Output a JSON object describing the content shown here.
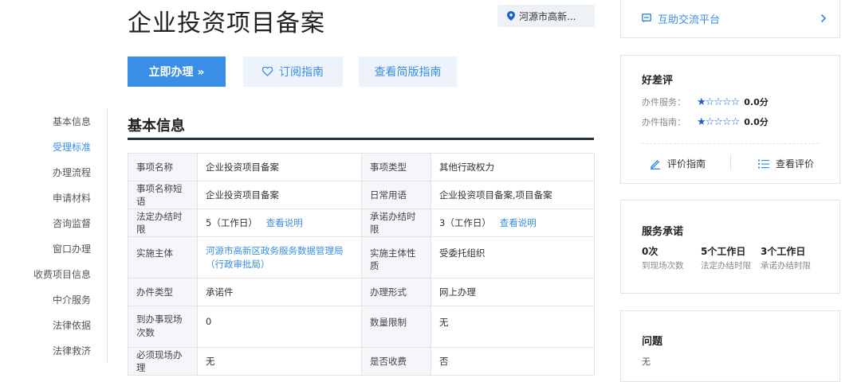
{
  "header": {
    "title": "企业投资项目备案",
    "location": "河源市高新..."
  },
  "actions": {
    "apply": "立即办理 »",
    "subscribe": "订阅指南",
    "brief": "查看简版指南"
  },
  "sidenav": {
    "items": [
      {
        "label": "基本信息",
        "active": false
      },
      {
        "label": "受理标准",
        "active": true
      },
      {
        "label": "办理流程",
        "active": false
      },
      {
        "label": "申请材料",
        "active": false
      },
      {
        "label": "咨询监督",
        "active": false
      },
      {
        "label": "窗口办理",
        "active": false
      },
      {
        "label": "收费项目信息",
        "active": false
      },
      {
        "label": "中介服务",
        "active": false
      },
      {
        "label": "法律依据",
        "active": false
      },
      {
        "label": "法律救济",
        "active": false
      }
    ]
  },
  "basic_info": {
    "title": "基本信息",
    "rows": [
      {
        "k1": "事项名称",
        "v1": "企业投资项目备案",
        "k2": "事项类型",
        "v2": "其他行政权力"
      },
      {
        "k1": "事项名称短语",
        "v1": "企业投资项目备案",
        "k2": "日常用语",
        "v2": "企业投资项目备案,项目备案"
      },
      {
        "k1": "法定办结时限",
        "v1": "5（工作日）",
        "link1": "查看说明",
        "k2": "承诺办结时限",
        "v2": "3（工作日）",
        "link2": "查看说明"
      },
      {
        "k1": "实施主体",
        "v1": "河源市高新区政务服务数据管理局（行政审批局）",
        "k2": "实施主体性质",
        "v2": "受委托组织"
      },
      {
        "k1": "办件类型",
        "v1": "承诺件",
        "k2": "办理形式",
        "v2": "网上办理"
      },
      {
        "k1": "到办事现场次数",
        "v1": "0",
        "k2": "数量限制",
        "v2": "无"
      },
      {
        "k1": "必须现场办理",
        "v1": "无",
        "k2": "是否收费",
        "v2": "否"
      }
    ]
  },
  "sidebar": {
    "help_platform": "互助交流平台",
    "rating": {
      "title": "好差评",
      "service_label": "办件服务：",
      "service_stars": "★☆☆☆☆",
      "service_score": "0.0分",
      "guide_label": "办件指南：",
      "guide_stars": "★☆☆☆☆",
      "guide_score": "0.0分",
      "evaluate_guide": "评价指南",
      "view_reviews": "查看评价"
    },
    "commitment": {
      "title": "服务承诺",
      "items": [
        {
          "value": "0次",
          "label": "到现场次数"
        },
        {
          "value": "5个工作日",
          "label": "法定办结时限"
        },
        {
          "value": "3个工作日",
          "label": "承诺办结时限"
        }
      ]
    },
    "question": {
      "title": "问题",
      "text": "无"
    }
  },
  "colors": {
    "primary": "#3a8ee6",
    "primary_light": "#edf3fb",
    "dark_rule": "#24303e",
    "star": "#1d5fd1"
  }
}
